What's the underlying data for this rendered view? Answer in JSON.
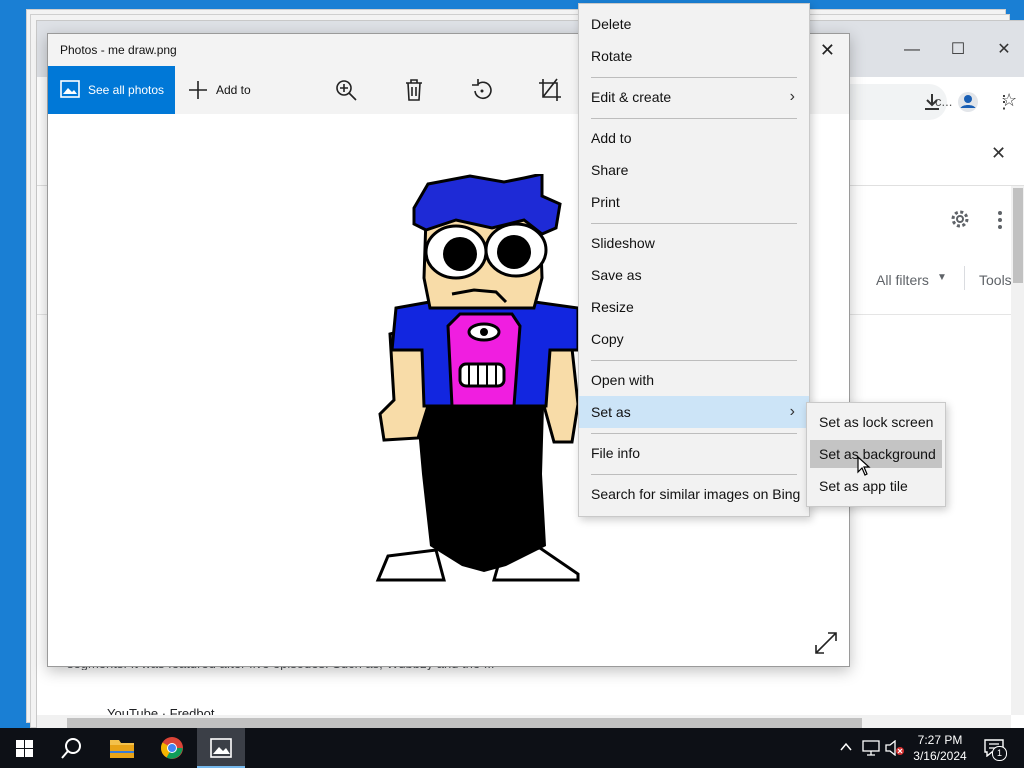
{
  "photos_window": {
    "title": "Photos - me draw.png",
    "toolbar": {
      "see_all_photos": "See all photos",
      "add_to": "Add to"
    }
  },
  "context_menu": {
    "items": [
      {
        "label": "Delete"
      },
      {
        "label": "Rotate"
      },
      {
        "label": "Edit & create"
      },
      {
        "label": "Add to"
      },
      {
        "label": "Share"
      },
      {
        "label": "Print"
      },
      {
        "label": "Slideshow"
      },
      {
        "label": "Save as"
      },
      {
        "label": "Resize"
      },
      {
        "label": "Copy"
      },
      {
        "label": "Open with"
      },
      {
        "label": "Set as"
      },
      {
        "label": "File info"
      },
      {
        "label": "Search for similar images on Bing"
      }
    ]
  },
  "submenu": {
    "items": [
      {
        "label": "Set as lock screen"
      },
      {
        "label": "Set as background"
      },
      {
        "label": "Set as app tile"
      }
    ]
  },
  "browser": {
    "omnibox_text": "c...",
    "filters_label": "All filters",
    "tools_label": "Tools",
    "snippet_text": "segments. It was featured after five episodes. Such as, Wubbzy and the ...",
    "result_source": "YouTube · Fredbot"
  },
  "taskbar": {
    "time": "7:27 PM",
    "date": "3/16/2024",
    "notification_count": "1"
  },
  "colors": {
    "accent": "#0078d7",
    "desktop": "#1a7fd4",
    "menu_highlight": "#cce4f7"
  }
}
